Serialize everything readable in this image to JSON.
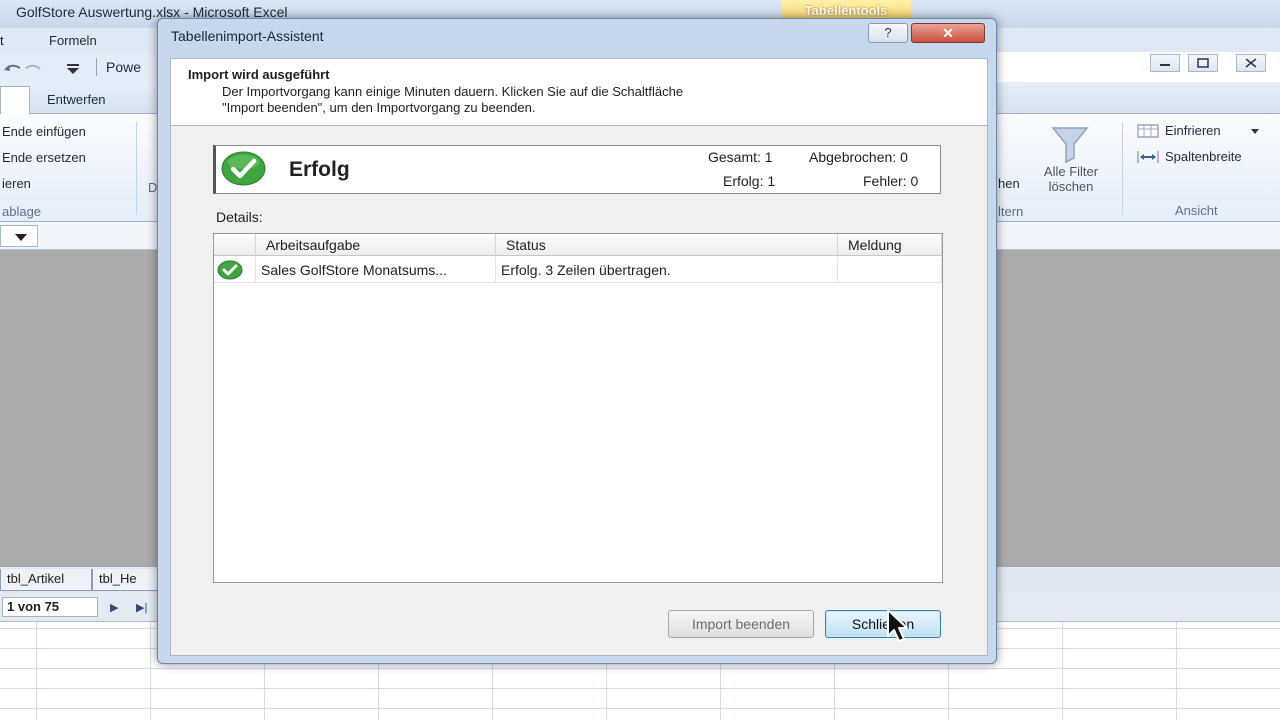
{
  "excel": {
    "title": "GolfStore Auswertung.xlsx  -  Microsoft Excel",
    "tool_tab": "Tabellentools",
    "menu_partial": "t",
    "menu_formeln": "Formeln",
    "qat_text": "Powe",
    "tab_entwerfen": "Entwerfen",
    "ribbon_left": [
      "Ende einfügen",
      "Ende ersetzen",
      "ieren"
    ],
    "ribbon_left_group": "ablage",
    "ribbon_left_partial": "D",
    "ribbon_mid_partial": "hen",
    "ribbon_mid_group": "ltern",
    "ribbon_filter": "Alle Filter\nlöschen",
    "ribbon_einfrieren": "Einfrieren",
    "ribbon_spaltenbreite": "Spaltenbreite",
    "ribbon_ansicht": "Ansicht",
    "sheet_tabs": [
      "tbl_Artikel",
      "tbl_He"
    ],
    "page_indicator": "1 von 75"
  },
  "dialog": {
    "title": "Tabellenimport-Assistent",
    "help": "?",
    "close": "✕",
    "header_title": "Import wird ausgeführt",
    "header_desc": "Der Importvorgang kann einige Minuten dauern. Klicken Sie auf die Schaltfläche\n\"Import beenden\", um den Importvorgang zu beenden.",
    "status": "Erfolg",
    "stats": {
      "gesamt": "Gesamt: 1",
      "abgebrochen": "Abgebrochen: 0",
      "erfolg": "Erfolg: 1",
      "fehler": "Fehler: 0"
    },
    "details_label": "Details:",
    "columns": [
      "Arbeitsaufgabe",
      "Status",
      "Meldung"
    ],
    "rows": [
      {
        "task": "Sales GolfStore Monatsums...",
        "status": "Erfolg. 3 Zeilen übertragen.",
        "message": ""
      }
    ],
    "buttons": {
      "stop": "Import beenden",
      "close": "Schließen"
    }
  },
  "colors": {
    "success_green": "#3fa63f",
    "dialog_frame": "#c8d8ec",
    "primary_button": "#bfe0f4"
  }
}
